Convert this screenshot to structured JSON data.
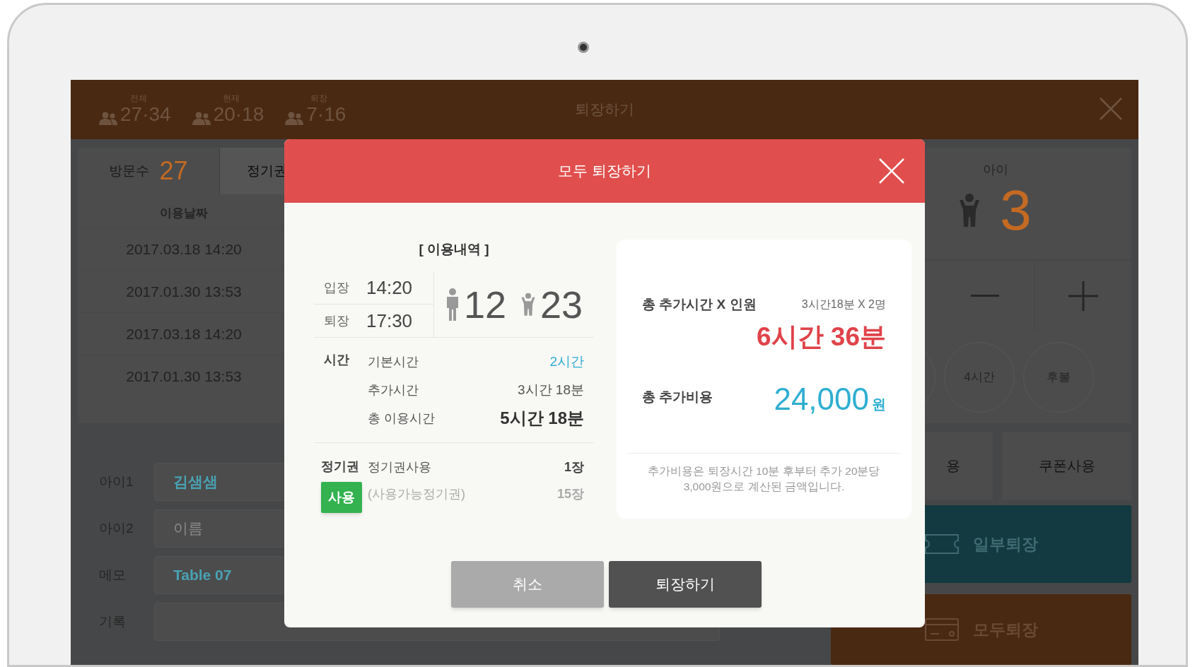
{
  "top_bar": {
    "stats": [
      {
        "label": "전체",
        "value": "27·34"
      },
      {
        "label": "현재",
        "value": "20·18"
      },
      {
        "label": "퇴장",
        "value": "7·16"
      }
    ],
    "title": "퇴장하기"
  },
  "visits": {
    "tabs": [
      {
        "label": "방문수",
        "count": "27",
        "selected": true
      },
      {
        "label": "정기권",
        "selected": false
      }
    ],
    "column": "이용날짜",
    "dates": [
      "2017.03.18 14:20",
      "2017.01.30 13:53",
      "2017.03.18 14:20",
      "2017.01.30 13:53"
    ]
  },
  "form": {
    "rows": [
      {
        "label": "아이1",
        "value": "김샘샘"
      },
      {
        "label": "아이2",
        "placeholder": "이름"
      },
      {
        "label": "메모",
        "value": "Table 07"
      },
      {
        "label": "기록"
      }
    ]
  },
  "counter": {
    "label": "아이",
    "count": "3"
  },
  "time_options": [
    "4시간",
    "후불"
  ],
  "actions": [
    {
      "label": "용",
      "kind": "cut"
    },
    {
      "label": "쿠폰사용",
      "kind": "plain"
    },
    {
      "label": "일부퇴장",
      "kind": "partial"
    },
    {
      "label": "모두퇴장",
      "kind": "all"
    }
  ],
  "modal": {
    "title": "모두 퇴장하기",
    "section_title": "[ 이용내역 ]",
    "entry": {
      "label": "입장",
      "time": "14:20"
    },
    "exit": {
      "label": "퇴장",
      "time": "17:30"
    },
    "adults": "12",
    "children": "23",
    "time_heading": "시간",
    "time_rows": [
      {
        "label": "기본시간",
        "value": "2시간",
        "kind": "highlight"
      },
      {
        "label": "추가시간",
        "value": "3시간 18분",
        "kind": "normal"
      },
      {
        "label": "총 이용시간",
        "value": "5시간 18분",
        "kind": "total"
      }
    ],
    "pass_heading": "정기권",
    "pass_button": "사용",
    "pass_rows": [
      {
        "label": "정기권사용",
        "value": "1장",
        "kind": "used"
      },
      {
        "label": "(사용가능정기권)",
        "value": "15장",
        "kind": "available"
      }
    ],
    "summary": {
      "extra_time_label": "총 추가시간 X 인원",
      "formula": "3시간18분 X 2명",
      "extra_time": "6시간 36분",
      "cost_label": "총 추가비용",
      "cost": "24,000",
      "currency": "원",
      "note": "추가비용은 퇴장시간 10분 후부터 추가 20분당 3,000원으로 계산된 금액입니다."
    },
    "buttons": [
      {
        "label": "취소",
        "kind": "cancel"
      },
      {
        "label": "퇴장하기",
        "kind": "confirm"
      }
    ]
  }
}
